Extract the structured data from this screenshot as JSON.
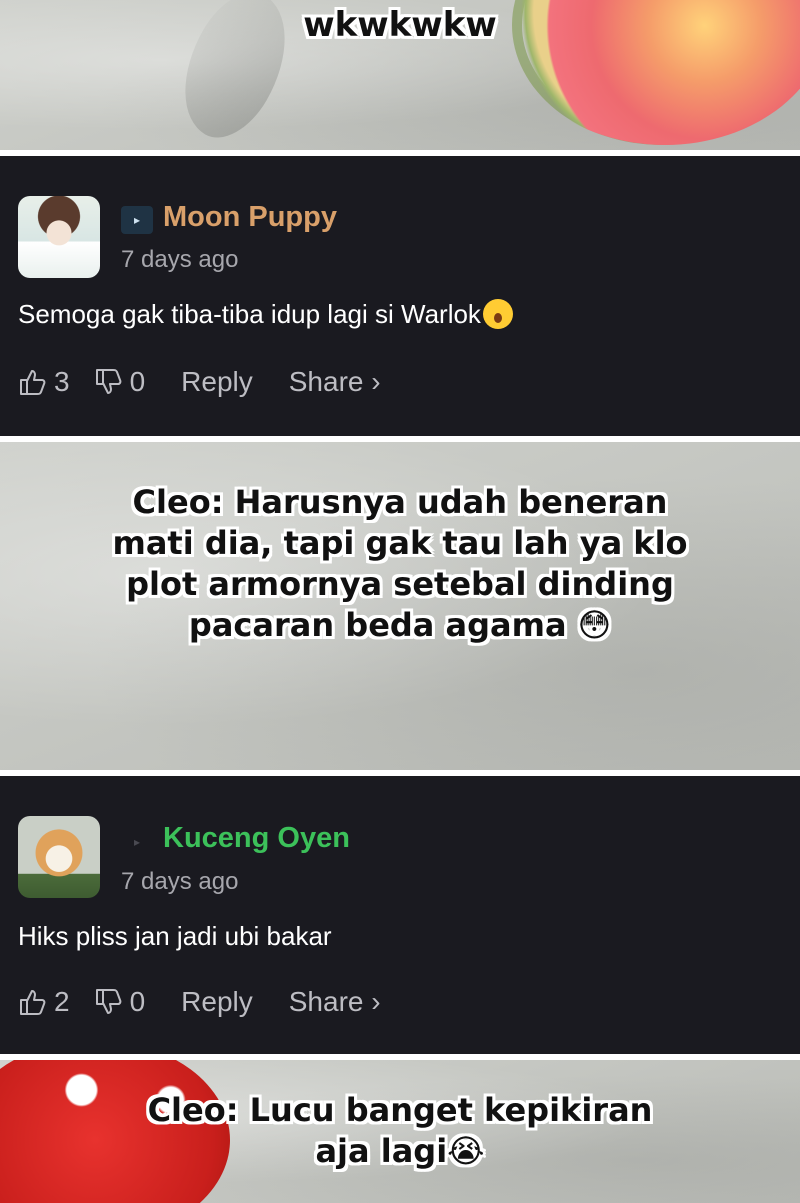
{
  "panels": {
    "top_caption": "wkwkwkw",
    "middle_caption": "Cleo: Harusnya udah beneran\nmati dia, tapi gak tau lah ya klo\nplot armornya setebal dinding\npacaran beda agama 😳",
    "bottom_caption": "Cleo: Lucu banget kepikiran\naja lagi😭"
  },
  "comments": [
    {
      "username": "Moon Puppy",
      "username_color": "#d9a06a",
      "time": "7 days ago",
      "text": "Semoga gak tiba-tiba idup lagi si Warlok",
      "likes": "3",
      "dislikes": "0",
      "reply": "Reply",
      "share": "Share ›"
    },
    {
      "username": "Kuceng Oyen",
      "username_color": "#3cc15a",
      "time": "7 days ago",
      "text": "Hiks pliss jan jadi ubi bakar",
      "likes": "2",
      "dislikes": "0",
      "reply": "Reply",
      "share": "Share ›"
    }
  ]
}
